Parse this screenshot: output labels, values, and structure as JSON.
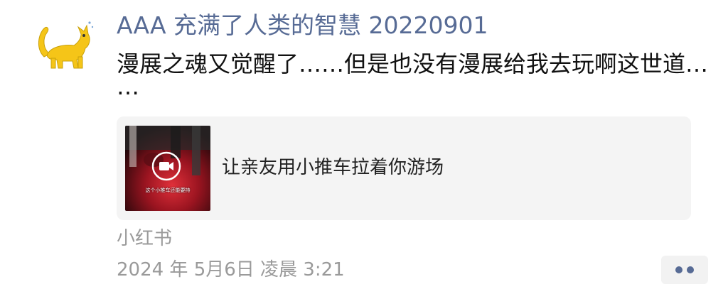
{
  "post": {
    "author": "AAA 充满了人类的智慧 20220901",
    "text_line1": "漫展之魂又觉醒了……但是也没有漫展给我去玩啊这世道…",
    "text_line2": "…",
    "card": {
      "title": "让亲友用小推车拉着你游场",
      "thumbnail_caption": "这个小推车还能要持",
      "media_type": "video"
    },
    "source": "小红书",
    "timestamp": "2024 年 5月6日 凌晨 3:21"
  },
  "icons": {
    "avatar": "yellow-cat-avatar",
    "play": "video-camera-icon",
    "more": "more-dots-icon"
  },
  "colors": {
    "author_name": "#576b95",
    "meta_text": "#9a9a9a",
    "card_bg": "#f4f4f4"
  }
}
